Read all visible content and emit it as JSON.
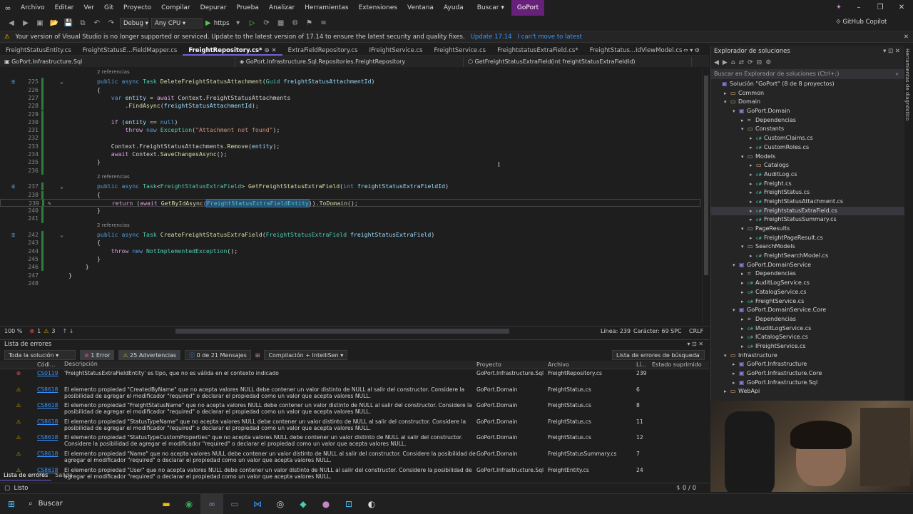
{
  "menu": [
    "Archivo",
    "Editar",
    "Ver",
    "Git",
    "Proyecto",
    "Compilar",
    "Depurar",
    "Prueba",
    "Analizar",
    "Herramientas",
    "Extensiones",
    "Ventana",
    "Ayuda"
  ],
  "search_menu": "Buscar",
  "solution_name": "GoPort",
  "toolbar": {
    "config": "Debug",
    "platform": "Any CPU",
    "run_target": "https",
    "copilot": "GitHub Copilot"
  },
  "banner": {
    "message": "Your version of Visual Studio is no longer supported or serviced. Update to the latest version of 17.14 to ensure the latest security and quality fixes.",
    "update": "Update 17.14",
    "cant_move": "I can't move to latest"
  },
  "tabs": [
    "FreightStatusEntity.cs",
    "FreightStatusE...FieldMapper.cs",
    "FreightRepository.cs*",
    "ExtraFieldRepository.cs",
    "IFreightService.cs",
    "FreightService.cs",
    "FreightstatusExtraField.cs*",
    "FreightStatus...IdViewModel.cs"
  ],
  "active_tab": 2,
  "navbar": {
    "project": "GoPort.Infrastructure.Sql",
    "class": "GoPort.Infrastructure.Sql.Repositories.FreightRepository",
    "member": "GetFreightStatusExtraField(int freightStatusExtraFieldId)"
  },
  "code": {
    "references": "2 referencias",
    "lines": [
      {
        "n": "225",
        "t": "public async Task DeleteFreightStatusAttachment(Guid freightStatusAttachmentId)"
      },
      {
        "n": "226",
        "t": "{"
      },
      {
        "n": "227",
        "t": "    var entity = await Context.FreightStatusAttachments"
      },
      {
        "n": "228",
        "t": "        .FindAsync(freightStatusAttachmentId);"
      },
      {
        "n": "229",
        "t": ""
      },
      {
        "n": "230",
        "t": "    if (entity == null)"
      },
      {
        "n": "231",
        "t": "        throw new Exception(\"Attachment not found\");"
      },
      {
        "n": "232",
        "t": ""
      },
      {
        "n": "233",
        "t": "    Context.FreightStatusAttachments.Remove(entity);"
      },
      {
        "n": "234",
        "t": "    await Context.SaveChangesAsync();"
      },
      {
        "n": "235",
        "t": "}"
      },
      {
        "n": "236",
        "t": ""
      },
      {
        "n": "237",
        "t": "public async Task<FreightStatusExtraField> GetFreightStatusExtraField(int freightStatusExtraFieldId)"
      },
      {
        "n": "238",
        "t": "{"
      },
      {
        "n": "239",
        "t": "    return (await GetByIdAsync(FreightStatusExtraFieldEntity)).ToDomain();"
      },
      {
        "n": "240",
        "t": "}"
      },
      {
        "n": "241",
        "t": ""
      },
      {
        "n": "242",
        "t": "public async Task CreateFreightStatusExtraField(FreightStatusExtraField freightStatusExtraField)"
      },
      {
        "n": "243",
        "t": "{"
      },
      {
        "n": "244",
        "t": "    throw new NotImplementedException();"
      },
      {
        "n": "245",
        "t": "}"
      },
      {
        "n": "246",
        "t": "    }"
      },
      {
        "n": "247",
        "t": "}"
      },
      {
        "n": "248",
        "t": ""
      }
    ]
  },
  "editor_status": {
    "zoom": "100 %",
    "errors": "1",
    "warnings": "3",
    "line": "Línea: 239",
    "char": "Carácter: 69",
    "spc": "SPC",
    "crlf": "CRLF"
  },
  "errorlist": {
    "title": "Lista de errores",
    "scope": "Toda la solución",
    "errors_btn": "1 Error",
    "warnings_btn": "25 Advertencias",
    "messages_btn": "0 de 21 Mensajes",
    "build_filter": "Compilación + IntelliSen",
    "search_placeholder": "Lista de errores de búsqueda",
    "headers": [
      "Códi...",
      "Descripción",
      "Proyecto",
      "Archivo",
      "Lí...",
      "Estado suprimido"
    ],
    "rows": [
      {
        "kind": "error",
        "code": "CS0119",
        "desc": "'FreightStatusExtraFieldEntity' es tipo, que no es válida en el contexto indicado",
        "proj": "GoPort.Infrastructure.Sql",
        "file": "FreightRepository.cs",
        "line": "239"
      },
      {
        "kind": "warn",
        "code": "CS8618",
        "desc": "El elemento propiedad \"CreatedByName\" que no acepta valores NULL debe contener un valor distinto de NULL al salir del constructor. Considere la posibilidad de agregar el modificador \"required\" o declarar el propiedad como un valor que acepta valores NULL.",
        "proj": "GoPort.Domain",
        "file": "FreightStatus.cs",
        "line": "6"
      },
      {
        "kind": "warn",
        "code": "CS8618",
        "desc": "El elemento propiedad \"FreightStatusName\" que no acepta valores NULL debe contener un valor distinto de NULL al salir del constructor. Considere la posibilidad de agregar el modificador \"required\" o declarar el propiedad como un valor que acepta valores NULL.",
        "proj": "GoPort.Domain",
        "file": "FreightStatus.cs",
        "line": "8"
      },
      {
        "kind": "warn",
        "code": "CS8618",
        "desc": "El elemento propiedad \"StatusTypeName\" que no acepta valores NULL debe contener un valor distinto de NULL al salir del constructor. Considere la posibilidad de agregar el modificador \"required\" o declarar el propiedad como un valor que acepta valores NULL.",
        "proj": "GoPort.Domain",
        "file": "FreightStatus.cs",
        "line": "11"
      },
      {
        "kind": "warn",
        "code": "CS8618",
        "desc": "El elemento propiedad \"StatusTypeCustomProperties\" que no acepta valores NULL debe contener un valor distinto de NULL al salir del constructor. Considere la posibilidad de agregar el modificador \"required\" o declarar el propiedad como un valor que acepta valores NULL.",
        "proj": "GoPort.Domain",
        "file": "FreightStatus.cs",
        "line": "12"
      },
      {
        "kind": "warn",
        "code": "CS8618",
        "desc": "El elemento propiedad \"Name\" que no acepta valores NULL debe contener un valor distinto de NULL al salir del constructor. Considere la posibilidad de agregar el modificador \"required\" o declarar el propiedad como un valor que acepta valores NULL.",
        "proj": "GoPort.Domain",
        "file": "FreightStatusSummary.cs",
        "line": "7"
      },
      {
        "kind": "warn",
        "code": "CS8618",
        "desc": "El elemento propiedad \"User\" que no acepta valores NULL debe contener un valor distinto de NULL al salir del constructor. Considere la posibilidad de agregar el modificador \"required\" o declarar el propiedad como un valor que acepta valores NULL.",
        "proj": "GoPort.Infrastructure.Sql",
        "file": "FreightEntity.cs",
        "line": "24"
      }
    ],
    "panel_tabs": [
      "Lista de errores",
      "Salida"
    ]
  },
  "solution_explorer": {
    "title": "Explorador de soluciones",
    "search": "Buscar en Explorador de soluciones (Ctrl+;)",
    "nodes": [
      {
        "d": 0,
        "a": "",
        "i": "pj",
        "t": "Solución \"GoPort\" (8 de 8 proyectos)"
      },
      {
        "d": 1,
        "a": "▸",
        "i": "fold",
        "t": "Common"
      },
      {
        "d": 1,
        "a": "▾",
        "i": "fold",
        "t": "Domain"
      },
      {
        "d": 2,
        "a": "▾",
        "i": "pj",
        "t": "GoPort.Domain"
      },
      {
        "d": 3,
        "a": "▸",
        "i": "dep",
        "t": "Dependencias"
      },
      {
        "d": 3,
        "a": "▾",
        "i": "fold",
        "t": "Constants"
      },
      {
        "d": 4,
        "a": "▸",
        "i": "cs",
        "t": "CustomClaims.cs"
      },
      {
        "d": 4,
        "a": "▸",
        "i": "cs",
        "t": "CustomRoles.cs"
      },
      {
        "d": 3,
        "a": "▾",
        "i": "fold",
        "t": "Models"
      },
      {
        "d": 4,
        "a": "▸",
        "i": "fold",
        "t": "Catalogs"
      },
      {
        "d": 4,
        "a": "▸",
        "i": "cs",
        "t": "AuditLog.cs"
      },
      {
        "d": 4,
        "a": "▸",
        "i": "cs",
        "t": "Freight.cs"
      },
      {
        "d": 4,
        "a": "▸",
        "i": "cs",
        "t": "FreightStatus.cs"
      },
      {
        "d": 4,
        "a": "▸",
        "i": "cs",
        "t": "FreightStatusAttachment.cs"
      },
      {
        "d": 4,
        "a": "▸",
        "i": "cs",
        "t": "FreightstatusExtraField.cs",
        "sel": true
      },
      {
        "d": 4,
        "a": "▸",
        "i": "cs",
        "t": "FreightStatusSummary.cs"
      },
      {
        "d": 3,
        "a": "▾",
        "i": "fold",
        "t": "PageResults"
      },
      {
        "d": 4,
        "a": "▸",
        "i": "cs",
        "t": "FreightPageResult.cs"
      },
      {
        "d": 3,
        "a": "▾",
        "i": "fold",
        "t": "SearchModels"
      },
      {
        "d": 4,
        "a": "▸",
        "i": "cs",
        "t": "FreightSearchModel.cs"
      },
      {
        "d": 2,
        "a": "▾",
        "i": "pj",
        "t": "GoPort.DomainService"
      },
      {
        "d": 3,
        "a": "▸",
        "i": "dep",
        "t": "Dependencias"
      },
      {
        "d": 3,
        "a": "▸",
        "i": "cs",
        "t": "AuditLogService.cs"
      },
      {
        "d": 3,
        "a": "▸",
        "i": "cs",
        "t": "CatalogService.cs"
      },
      {
        "d": 3,
        "a": "▸",
        "i": "cs",
        "t": "FreightService.cs"
      },
      {
        "d": 2,
        "a": "▾",
        "i": "pj",
        "t": "GoPort.DomainService.Core"
      },
      {
        "d": 3,
        "a": "▸",
        "i": "dep",
        "t": "Dependencias"
      },
      {
        "d": 3,
        "a": "▸",
        "i": "cs",
        "t": "IAuditLogService.cs"
      },
      {
        "d": 3,
        "a": "▸",
        "i": "cs",
        "t": "ICatalogService.cs"
      },
      {
        "d": 3,
        "a": "▸",
        "i": "cs",
        "t": "IFreightService.cs"
      },
      {
        "d": 1,
        "a": "▾",
        "i": "fold",
        "t": "Infrastructure"
      },
      {
        "d": 2,
        "a": "▸",
        "i": "pj",
        "t": "GoPort.Infrastructure"
      },
      {
        "d": 2,
        "a": "▸",
        "i": "pj",
        "t": "GoPort.Infrastructure.Core"
      },
      {
        "d": 2,
        "a": "▸",
        "i": "pj",
        "t": "GoPort.Infrastructure.Sql"
      },
      {
        "d": 1,
        "a": "▸",
        "i": "fold",
        "t": "WebApi"
      }
    ]
  },
  "side_label": "Herramientas de diagnóstico",
  "status": {
    "left": "Listo",
    "right": "0 / 0"
  },
  "taskbar": {
    "search": "Buscar"
  },
  "colors": {
    "accent": "#68217a",
    "error": "#f14c4c",
    "warning": "#cca700"
  }
}
